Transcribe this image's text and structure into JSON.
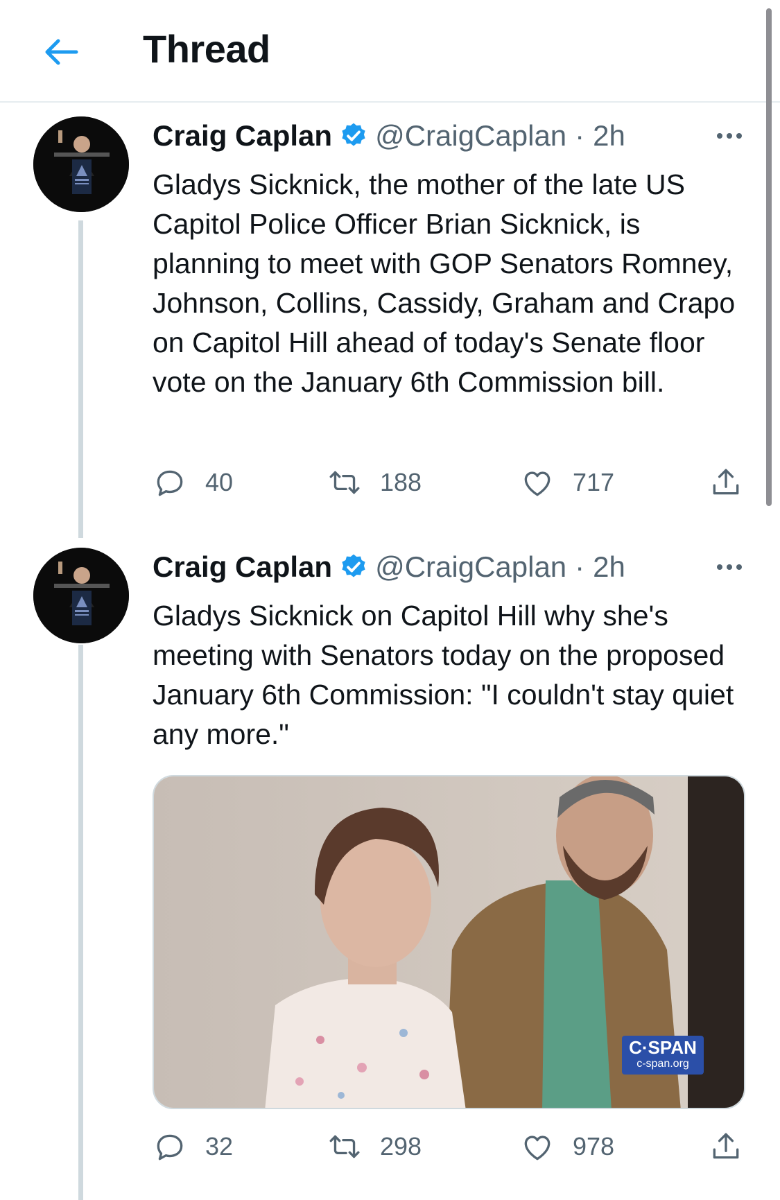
{
  "header": {
    "title": "Thread"
  },
  "colors": {
    "accent": "#1d9bf0",
    "muted": "#536471",
    "thread_line": "#cfd9de"
  },
  "icons": {
    "back": "arrow-left-icon",
    "verified": "verified-badge-icon",
    "more": "more-horizontal-icon",
    "reply": "reply-icon",
    "retweet": "retweet-icon",
    "like": "heart-icon",
    "share": "share-icon"
  },
  "tweets": [
    {
      "name": "Craig Caplan",
      "handle": "@CraigCaplan",
      "separator": "·",
      "time": "2h",
      "text": "Gladys Sicknick, the mother of the late US Capitol Police Officer Brian Sicknick, is planning to meet with GOP Senators Romney, Johnson, Collins, Cassidy, Graham and Crapo on Capitol Hill ahead of today's Senate floor vote on the January 6th Commission bill.",
      "replies": "40",
      "retweets": "188",
      "likes": "717"
    },
    {
      "name": "Craig Caplan",
      "handle": "@CraigCaplan",
      "separator": "·",
      "time": "2h",
      "text": "Gladys Sicknick on Capitol Hill why she's meeting with Senators today on the proposed January 6th Commission: \"I couldn't stay quiet any more.\"",
      "media": {
        "watermark_brand": "C·SPAN",
        "watermark_url": "c-span.org"
      },
      "replies": "32",
      "retweets": "298",
      "likes": "978"
    }
  ]
}
